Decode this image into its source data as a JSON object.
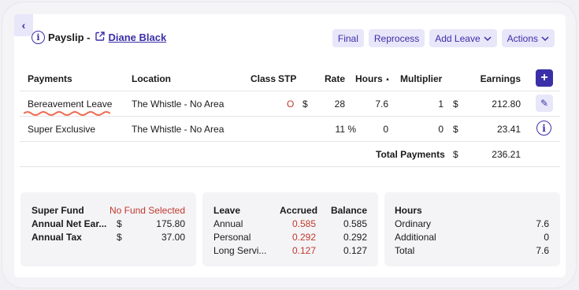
{
  "header": {
    "back_icon": "chevron-left-icon",
    "title": "Payslip -",
    "employee_name": "Diane Black",
    "buttons": {
      "final": "Final",
      "reprocess": "Reprocess",
      "add_leave": "Add Leave",
      "actions": "Actions"
    },
    "accent_color": "#3b2fa8"
  },
  "table": {
    "headers": {
      "payments": "Payments",
      "location": "Location",
      "class": "Class",
      "stp": "STP",
      "rate": "Rate",
      "hours": "Hours",
      "sort_indicator": "▲",
      "multiplier": "Multiplier",
      "earnings": "Earnings"
    },
    "rows": [
      {
        "payment": "Bereavement Leave",
        "location": "The Whistle - No Area",
        "stp": "O",
        "rate_currency": "$",
        "rate": "28",
        "hours": "7.6",
        "multiplier": "1",
        "earnings_currency": "$",
        "earnings": "212.80"
      },
      {
        "payment": "Super Exclusive",
        "location": "The Whistle - No Area",
        "rate": "11 %",
        "hours": "0",
        "multiplier": "0",
        "earnings_currency": "$",
        "earnings": "23.41"
      }
    ],
    "total_label": "Total Payments",
    "total_currency": "$",
    "total": "236.21"
  },
  "super_panel": {
    "super_fund_label": "Super Fund",
    "super_fund_value": "No Fund Selected",
    "net_label": "Annual Net Ear...",
    "net_currency": "$",
    "net_value": "175.80",
    "tax_label": "Annual Tax",
    "tax_currency": "$",
    "tax_value": "37.00"
  },
  "leave_panel": {
    "headers": {
      "leave": "Leave",
      "accrued": "Accrued",
      "balance": "Balance"
    },
    "rows": [
      {
        "name": "Annual",
        "accrued": "0.585",
        "balance": "0.585"
      },
      {
        "name": "Personal",
        "accrued": "0.292",
        "balance": "0.292"
      },
      {
        "name": "Long Servi...",
        "accrued": "0.127",
        "balance": "0.127"
      }
    ]
  },
  "hours_panel": {
    "title": "Hours",
    "rows": [
      {
        "label": "Ordinary",
        "value": "7.6"
      },
      {
        "label": "Additional",
        "value": "0"
      },
      {
        "label": "Total",
        "value": "7.6"
      }
    ]
  }
}
